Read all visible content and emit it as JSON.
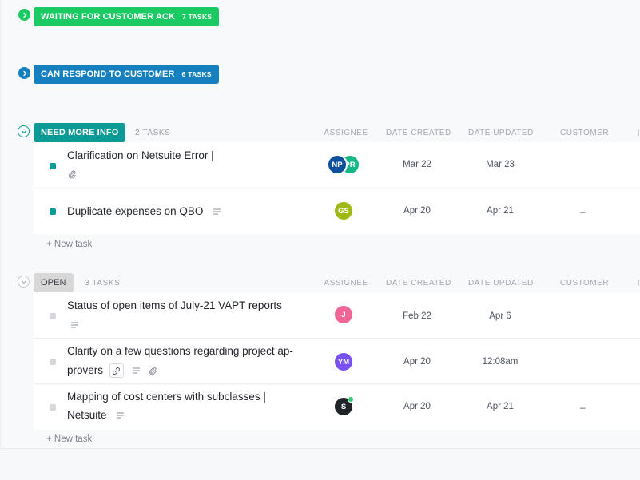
{
  "groups": {
    "waiting": {
      "label": "WAITING FOR CUSTOMER ACK",
      "count": "7 TASKS",
      "color": "#1bca63"
    },
    "can_respond": {
      "label": "CAN RESPOND TO CUSTOMER",
      "count": "6 TASKS",
      "color": "#1580bf"
    },
    "need_more_info": {
      "label": "NEED MORE INFO",
      "count": "2 TASKS",
      "color": "#0b9a96",
      "columns": [
        "ASSIGNEE",
        "DATE CREATED",
        "DATE UPDATED",
        "CUSTOMER"
      ],
      "tasks": [
        {
          "name": "Clarification on Netsuite Error |",
          "created": "Mar 22",
          "updated": "Mar 23",
          "customer": "",
          "assignees": [
            "NP",
            "PR"
          ],
          "icons": [
            "paperclip-icon"
          ]
        },
        {
          "name": "Duplicate expenses on QBO",
          "created": "Apr 20",
          "updated": "Apr 21",
          "customer": "–",
          "assignees": [
            "GS"
          ],
          "icons": [
            "description-icon"
          ]
        }
      ],
      "new_task": "+ New task"
    },
    "open": {
      "label": "OPEN",
      "count": "3 TASKS",
      "color": "#d8d8d8",
      "columns": [
        "ASSIGNEE",
        "DATE CREATED",
        "DATE UPDATED",
        "CUSTOMER"
      ],
      "tasks": [
        {
          "name": "Status of open items of July-21 VAPT reports",
          "created": "Feb 22",
          "updated": "Apr 6",
          "customer": "",
          "assignees": [
            "J"
          ],
          "icons": [
            "description-icon"
          ]
        },
        {
          "name_line1": "Clarity on a few questions regarding project ap-",
          "name_line2": "provers",
          "created": "Apr 20",
          "updated": "12:08am",
          "customer": "",
          "assignees": [
            "YM"
          ],
          "icons": [
            "link-icon",
            "description-icon",
            "paperclip-icon"
          ]
        },
        {
          "name_line1": "Mapping of cost centers with subclasses |",
          "name_line2": "Netsuite",
          "created": "Apr 20",
          "updated": "Apr 21",
          "customer": "–",
          "assignees": [
            "S"
          ],
          "icons": [
            "description-icon"
          ]
        }
      ],
      "new_task": "+ New task"
    }
  },
  "avatar_colors": {
    "NP": "#0d4f9c",
    "PR": "#12b886",
    "GS": "#a0b814",
    "J": "#f06595",
    "YM": "#7950f2",
    "S": "#212529"
  }
}
